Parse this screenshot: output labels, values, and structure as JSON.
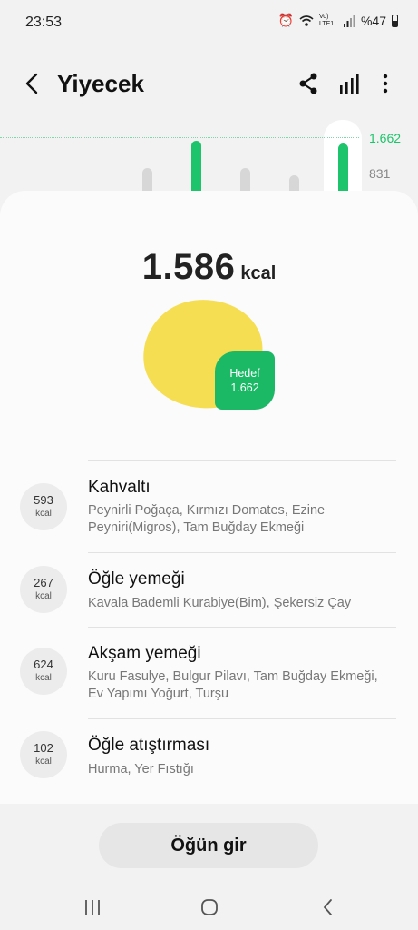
{
  "status_bar": {
    "time": "23:53",
    "network": "Vo) LTE1",
    "battery": "%47"
  },
  "header": {
    "title": "Yiyecek"
  },
  "chart_data": {
    "type": "bar",
    "y_tick_labels": [
      "1.662",
      "831"
    ],
    "goal_line": 1662,
    "bars": [
      {
        "value": 831,
        "color": "grey"
      },
      {
        "value": 1662,
        "color": "green"
      },
      {
        "value": 831,
        "color": "grey"
      },
      {
        "value": 600,
        "color": "grey"
      },
      {
        "value": 1586,
        "color": "green",
        "selected": true
      }
    ]
  },
  "summary": {
    "total": "1.586",
    "unit": "kcal",
    "goal_label": "Hedef",
    "goal_value": "1.662"
  },
  "meals": [
    {
      "kcal": "593",
      "unit": "kcal",
      "name": "Kahvaltı",
      "desc": "Peynirli Poğaça, Kırmızı Domates, Ezine Peyniri(Migros), Tam Buğday Ekmeği"
    },
    {
      "kcal": "267",
      "unit": "kcal",
      "name": "Öğle yemeği",
      "desc": "Kavala Bademli Kurabiye(Bim), Şekersiz Çay"
    },
    {
      "kcal": "624",
      "unit": "kcal",
      "name": "Akşam yemeği",
      "desc": "Kuru Fasulye, Bulgur Pilavı, Tam Buğday Ekmeği, Ev Yapımı Yoğurt, Turşu"
    },
    {
      "kcal": "102",
      "unit": "kcal",
      "name": "Öğle atıştırması",
      "desc": "Hurma, Yer Fıstığı"
    }
  ],
  "cta": {
    "label": "Öğün gir"
  },
  "colors": {
    "accent": "#1ec46b",
    "blob": "#f6de52",
    "badge": "#1bb865"
  }
}
